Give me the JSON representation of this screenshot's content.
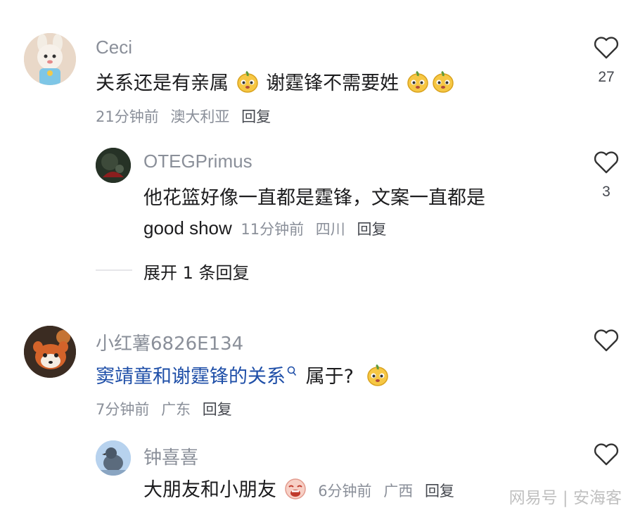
{
  "comments": [
    {
      "username": "Ceci",
      "text_parts": [
        "关系还是有亲属",
        "谢霆锋不需要姓"
      ],
      "time": "21分钟前",
      "location": "澳大利亚",
      "reply": "回复",
      "likes": "27",
      "avatar_icon": "cartoon-bunny-avatar"
    },
    {
      "username": "OTEGPrimus",
      "text_line1": "他花篮好像一直都是霆锋，文案一直都是",
      "text_line2": "good show",
      "time": "11分钟前",
      "location": "四川",
      "reply": "回复",
      "likes": "3",
      "avatar_icon": "dark-photo-avatar"
    },
    {
      "expand_label": "展开 1 条回复"
    },
    {
      "username": "小红薯6826E134",
      "text_part1": "窦靖童和谢霆锋的关系",
      "search_icon": "search-icon",
      "text_part2": "属于?",
      "time": "7分钟前",
      "location": "广东",
      "reply": "回复",
      "avatar_icon": "red-panda-avatar"
    },
    {
      "username": "钟喜喜",
      "text": "大朋友和小朋友",
      "time": "6分钟前",
      "location": "广西",
      "reply": "回复",
      "avatar_icon": "pigeon-avatar"
    }
  ],
  "watermark": "网易号 | 安海客",
  "colors": {
    "secondary_text": "#8a8f99",
    "primary_text": "#1c1c1e",
    "emoji_yellow": "#f6c744"
  }
}
